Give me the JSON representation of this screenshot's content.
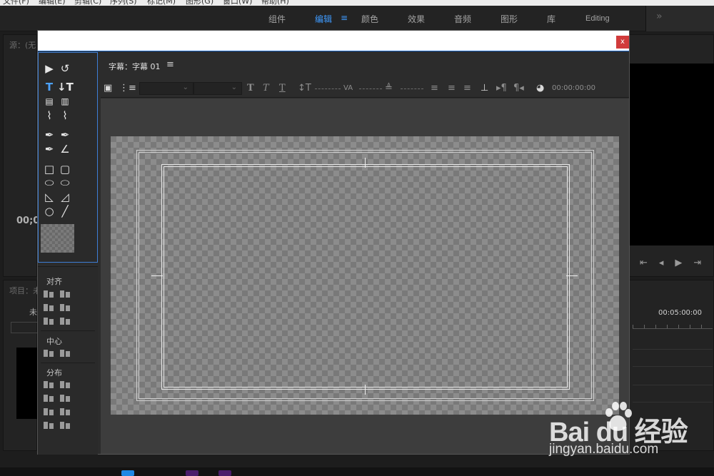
{
  "menubar": {
    "items": [
      "文件(F)",
      "编辑(E)",
      "剪辑(C)",
      "序列(S)",
      "标记(M)",
      "图形(G)",
      "窗口(W)",
      "帮助(H)"
    ]
  },
  "workspaces": {
    "tabs": [
      {
        "label": "组件",
        "active": false
      },
      {
        "label": "编辑",
        "active": true
      },
      {
        "label": "颜色",
        "active": false
      },
      {
        "label": "效果",
        "active": false
      },
      {
        "label": "音频",
        "active": false
      },
      {
        "label": "图形",
        "active": false
      },
      {
        "label": "库",
        "active": false
      },
      {
        "label": "Editing",
        "active": false
      }
    ],
    "menu_glyph": "≡",
    "overflow_glyph": "»"
  },
  "source_panel": {
    "tab_label": "源：(无",
    "timecode": "00;0"
  },
  "project_panel": {
    "tab_label": "项目：未",
    "item_label": "未"
  },
  "timeline_panel": {
    "timecode": "00:05:00:00"
  },
  "titler": {
    "close_label": "x",
    "header": {
      "title_name": "字幕：字幕 01",
      "menu_glyph": "≡"
    },
    "toolbar": {
      "timecode": "00:00:00:00",
      "bold": "T",
      "italic": "T",
      "underline": "T"
    },
    "align_panel": {
      "align_label": "对齐",
      "center_label": "中心",
      "distribute_label": "分布"
    }
  },
  "watermark": {
    "brand": "Bai du 经验",
    "url": "jingyan.baidu.com"
  },
  "colors": {
    "accent": "#3f9bff",
    "close": "#d13b3b",
    "selection_border": "#3d7ed6"
  }
}
